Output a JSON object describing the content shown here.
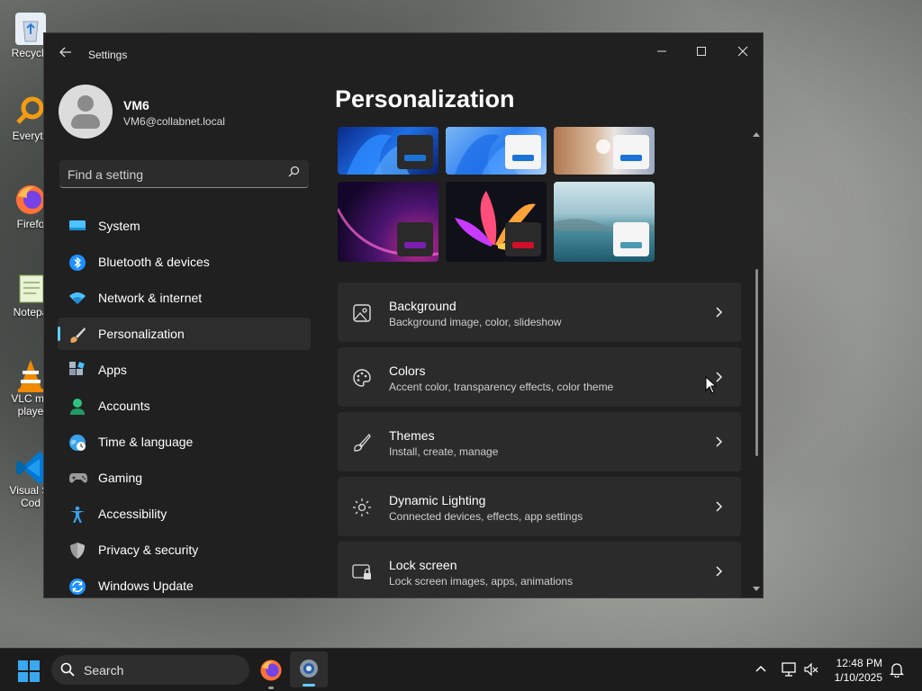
{
  "desktop": {
    "icons": [
      {
        "name": "recycle-bin",
        "label": "Recycle"
      },
      {
        "name": "everything",
        "label": "Everyth"
      },
      {
        "name": "firefox",
        "label": "Firefo"
      },
      {
        "name": "notepad",
        "label": "Notepa"
      },
      {
        "name": "vlc",
        "label": "VLC me\nplaye"
      },
      {
        "name": "vscode",
        "label": "Visual St\nCod"
      }
    ]
  },
  "window": {
    "title": "Settings",
    "minimize_icon": "minimize-icon",
    "maximize_icon": "maximize-icon",
    "close_icon": "close-icon"
  },
  "user": {
    "name": "VM6",
    "email": "VM6@collabnet.local"
  },
  "search": {
    "placeholder": "Find a setting"
  },
  "nav": {
    "items": [
      {
        "label": "System",
        "icon": "system-icon",
        "color": "#4cc2ff"
      },
      {
        "label": "Bluetooth & devices",
        "icon": "bluetooth-icon",
        "color": "#1e90ff"
      },
      {
        "label": "Network & internet",
        "icon": "network-icon",
        "color": "#4cc2ff"
      },
      {
        "label": "Personalization",
        "icon": "brush-icon",
        "color": "#e8a65c",
        "active": true
      },
      {
        "label": "Apps",
        "icon": "apps-icon",
        "color": "#8a9bb0"
      },
      {
        "label": "Accounts",
        "icon": "accounts-icon",
        "color": "#2ec27e"
      },
      {
        "label": "Time & language",
        "icon": "time-language-icon",
        "color": "#3aa0e8"
      },
      {
        "label": "Gaming",
        "icon": "gaming-icon",
        "color": "#9a9a9a"
      },
      {
        "label": "Accessibility",
        "icon": "accessibility-icon",
        "color": "#3aa0e8"
      },
      {
        "label": "Privacy & security",
        "icon": "shield-icon",
        "color": "#9a9a9a"
      },
      {
        "label": "Windows Update",
        "icon": "windows-update-icon",
        "color": "#1e90ff"
      }
    ]
  },
  "content": {
    "title": "Personalization",
    "themes": [
      {
        "name": "windows-light-theme",
        "accent": "#1a73d9"
      },
      {
        "name": "windows-blue-theme",
        "accent": "#1a73d9"
      },
      {
        "name": "flower-theme",
        "accent": "#1a73d9"
      },
      {
        "name": "glow-theme",
        "accent": "#7a1fb0"
      },
      {
        "name": "captured-motion-theme",
        "accent": "#d0102a"
      },
      {
        "name": "sunrise-theme",
        "accent": "#4b9bb0"
      }
    ],
    "cards": [
      {
        "title": "Background",
        "subtitle": "Background image, color, slideshow",
        "icon": "image-icon"
      },
      {
        "title": "Colors",
        "subtitle": "Accent color, transparency effects, color theme",
        "icon": "palette-icon"
      },
      {
        "title": "Themes",
        "subtitle": "Install, create, manage",
        "icon": "brush-icon"
      },
      {
        "title": "Dynamic Lighting",
        "subtitle": "Connected devices, effects, app settings",
        "icon": "dynamic-lighting-icon"
      },
      {
        "title": "Lock screen",
        "subtitle": "Lock screen images, apps, animations",
        "icon": "lock-screen-icon"
      }
    ]
  },
  "taskbar": {
    "search_label": "Search",
    "time": "12:48 PM",
    "date": "1/10/2025"
  }
}
